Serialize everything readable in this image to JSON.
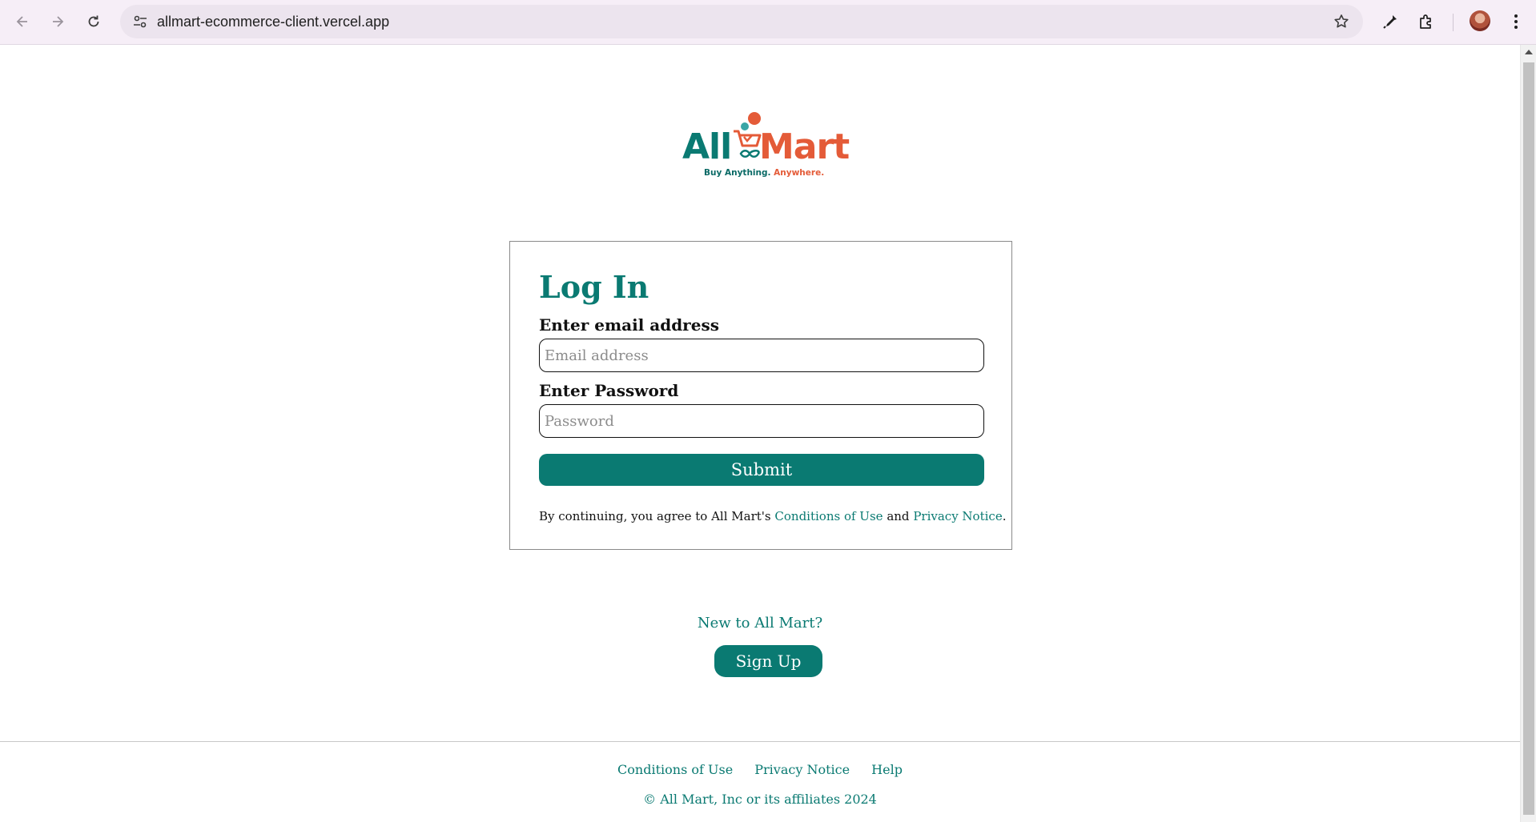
{
  "browser": {
    "url": "allmart-ecommerce-client.vercel.app",
    "icons": [
      "back-arrow-icon",
      "forward-arrow-icon",
      "reload-icon",
      "site-settings-icon",
      "bookmark-star-icon",
      "eyedropper-icon",
      "extensions-puzzle-icon",
      "kebab-menu-icon"
    ]
  },
  "logo": {
    "brand_left": "All",
    "brand_right": "Mart",
    "tagline_part1": "Buy Anything.",
    "tagline_part2": "Anywhere.",
    "colors": {
      "teal": "#0a7a72",
      "orange": "#e45b38"
    }
  },
  "login": {
    "title": "Log In",
    "email_label": "Enter email address",
    "email_placeholder": "Email address",
    "email_value": "",
    "password_label": "Enter Password",
    "password_placeholder": "Password",
    "password_value": "",
    "submit_label": "Submit",
    "agree_prefix": "By continuing, you agree to All Mart's",
    "agree_conditions": "Conditions of Use",
    "agree_and": "and",
    "agree_privacy": "Privacy Notice",
    "agree_suffix": "."
  },
  "signup": {
    "prompt": "New to All Mart?",
    "button_label": "Sign Up"
  },
  "footer": {
    "links": [
      "Conditions of Use",
      "Privacy Notice",
      "Help"
    ],
    "copyright": "© All Mart, Inc or its affiliates 2024"
  },
  "theme": {
    "accent": "#0a7a72",
    "chrome_bg": "#f6eef7",
    "omnibox_bg": "#ece4ee"
  }
}
